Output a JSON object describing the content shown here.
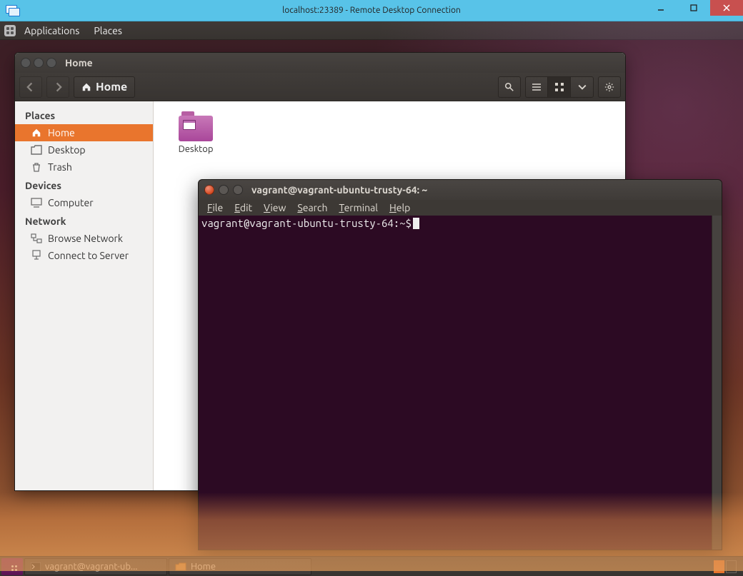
{
  "host_window": {
    "title": "localhost:23389 - Remote Desktop Connection",
    "minimize": "Minimize",
    "maximize": "Maximize",
    "close": "Close"
  },
  "gnome_top": {
    "applications": "Applications",
    "places": "Places"
  },
  "nautilus": {
    "title": "Home",
    "toolbar": {
      "back": "Back",
      "forward": "Forward",
      "path_home": "Home",
      "search": "Search",
      "view_list": "List view",
      "view_icons": "Icon view",
      "view_menu": "View options",
      "gear": "Settings"
    },
    "sidebar": {
      "heads": {
        "places": "Places",
        "devices": "Devices",
        "network": "Network"
      },
      "places": [
        {
          "label": "Home",
          "icon": "home-icon",
          "active": true
        },
        {
          "label": "Desktop",
          "icon": "desktop-icon"
        },
        {
          "label": "Trash",
          "icon": "trash-icon"
        }
      ],
      "devices": [
        {
          "label": "Computer",
          "icon": "computer-icon"
        }
      ],
      "network": [
        {
          "label": "Browse Network",
          "icon": "network-icon"
        },
        {
          "label": "Connect to Server",
          "icon": "server-icon"
        }
      ]
    },
    "files": [
      {
        "label": "Desktop"
      }
    ]
  },
  "terminal": {
    "title": "vagrant@vagrant-ubuntu-trusty-64: ~",
    "menus": {
      "file": "File",
      "edit": "Edit",
      "view": "View",
      "search": "Search",
      "terminal": "Terminal",
      "help": "Help"
    },
    "prompt": "vagrant@vagrant-ubuntu-trusty-64:~$ "
  },
  "taskbar": {
    "items": [
      {
        "label": "vagrant@vagrant-ub...",
        "icon": "terminal-icon"
      },
      {
        "label": "Home",
        "icon": "folder-icon"
      }
    ]
  }
}
